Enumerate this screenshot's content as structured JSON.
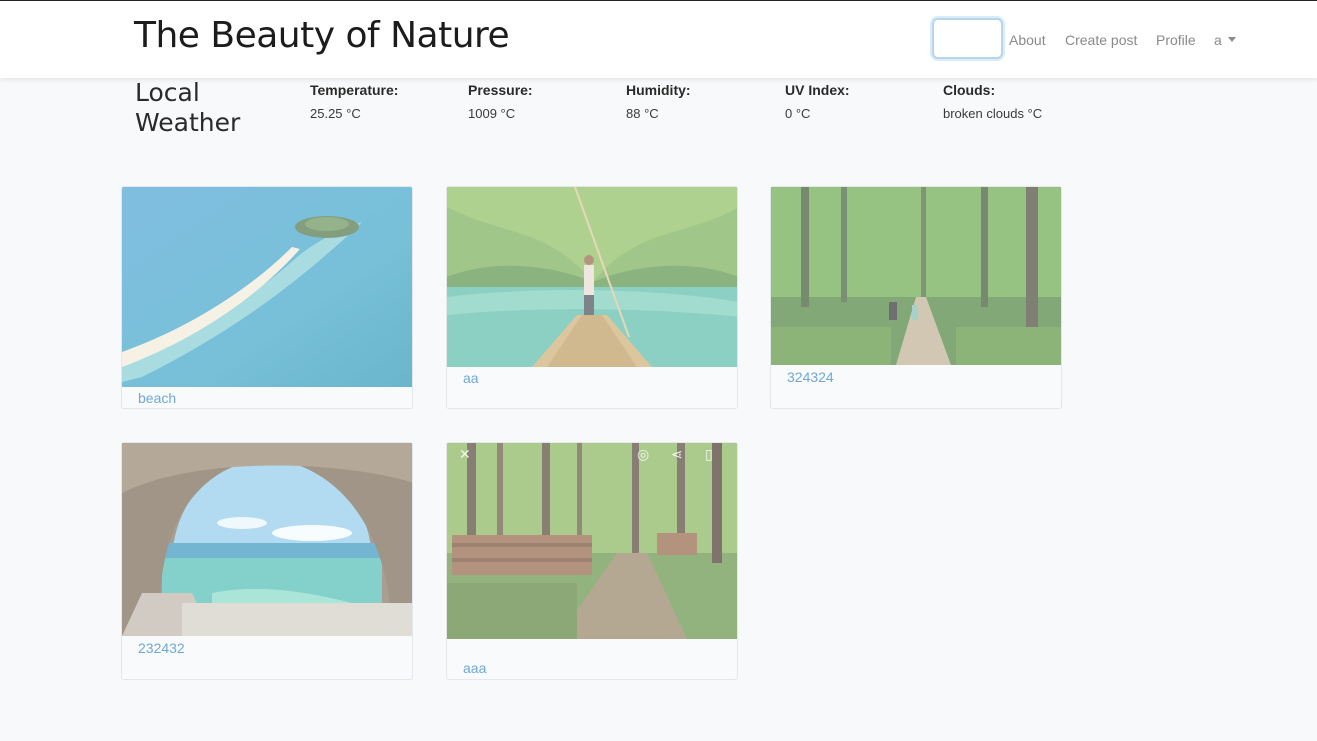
{
  "nav": {
    "brand": "The Beauty of Nature",
    "about": "About",
    "create_post": "Create post",
    "profile": "Profile",
    "user": "a"
  },
  "weather": {
    "title": "Local Weather",
    "items": [
      {
        "label": "Temperature:",
        "value": "25.25 °C"
      },
      {
        "label": "Pressure:",
        "value": "1009 °C"
      },
      {
        "label": "Humidity:",
        "value": "88 °C"
      },
      {
        "label": "UV Index:",
        "value": "0 °C"
      },
      {
        "label": "Clouds:",
        "value": "broken clouds °C"
      }
    ]
  },
  "posts": [
    {
      "title": "beach"
    },
    {
      "title": "aa"
    },
    {
      "title": "324324"
    },
    {
      "title": "232432"
    },
    {
      "title": "aaa"
    }
  ]
}
